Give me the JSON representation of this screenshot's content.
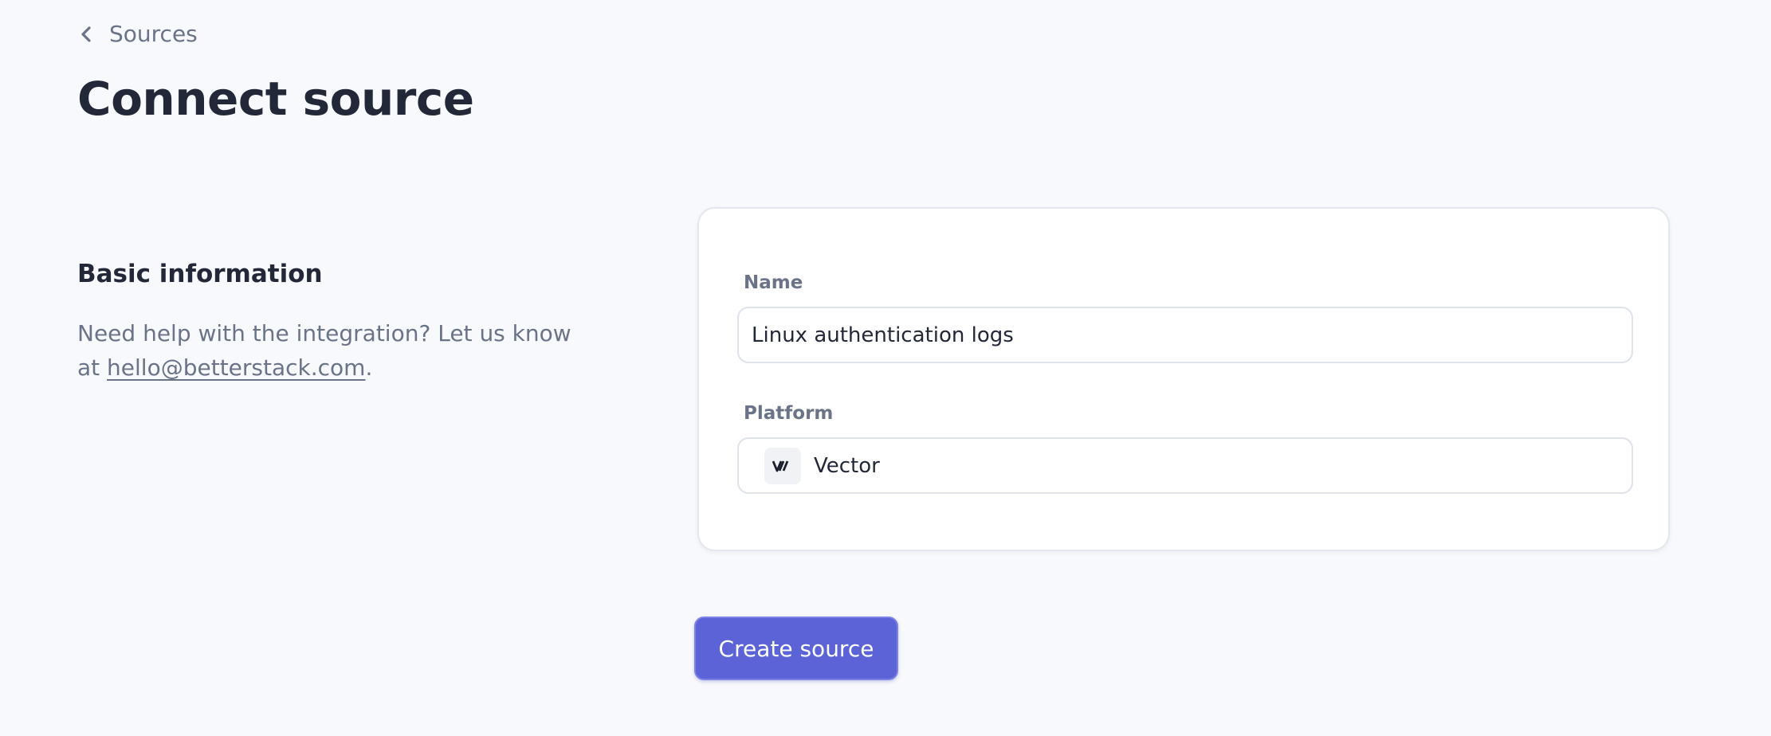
{
  "breadcrumb": {
    "back_label": "Sources",
    "icon": "chevron-left-icon"
  },
  "page": {
    "title": "Connect source"
  },
  "section": {
    "heading": "Basic information",
    "help_text_prefix": "Need help with the integration? Let us know at ",
    "help_email": "hello@betterstack.com",
    "help_text_suffix": "."
  },
  "form": {
    "name": {
      "label": "Name",
      "value": "Linux authentication logs"
    },
    "platform": {
      "label": "Platform",
      "selected": "Vector",
      "icon": "vector-logo-icon"
    }
  },
  "actions": {
    "create_label": "Create source",
    "create_color": "#5b63d6"
  },
  "colors": {
    "background": "#f7f9fc",
    "text_primary": "#222838",
    "text_muted": "#6b7389",
    "accent": "#5b63d6"
  }
}
